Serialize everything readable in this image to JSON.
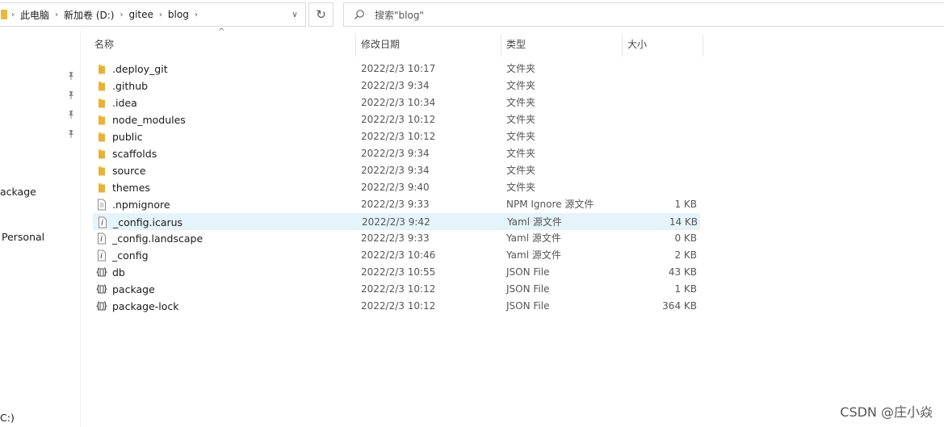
{
  "address": {
    "crumbs": [
      "此电脑",
      "新加卷 (D:)",
      "gitee",
      "blog"
    ],
    "dropdown_glyph": "∨",
    "refresh_glyph": "↻"
  },
  "search": {
    "placeholder": "搜索\"blog\"",
    "icon": "search-icon"
  },
  "nav": {
    "items": [
      {
        "label": "ackage"
      },
      {
        "label": "Personal"
      },
      {
        "label": "C:)"
      }
    ]
  },
  "columns": {
    "name": "名称",
    "date": "修改日期",
    "type": "类型",
    "size": "大小"
  },
  "files": [
    {
      "name": ".deploy_git",
      "date": "2022/2/3 10:17",
      "type": "文件夹",
      "size": "",
      "icon": "folder-icon"
    },
    {
      "name": ".github",
      "date": "2022/2/3 9:34",
      "type": "文件夹",
      "size": "",
      "icon": "folder-icon"
    },
    {
      "name": ".idea",
      "date": "2022/2/3 10:34",
      "type": "文件夹",
      "size": "",
      "icon": "folder-icon"
    },
    {
      "name": "node_modules",
      "date": "2022/2/3 10:12",
      "type": "文件夹",
      "size": "",
      "icon": "folder-icon"
    },
    {
      "name": "public",
      "date": "2022/2/3 10:12",
      "type": "文件夹",
      "size": "",
      "icon": "folder-icon"
    },
    {
      "name": "scaffolds",
      "date": "2022/2/3 9:34",
      "type": "文件夹",
      "size": "",
      "icon": "folder-icon"
    },
    {
      "name": "source",
      "date": "2022/2/3 9:34",
      "type": "文件夹",
      "size": "",
      "icon": "folder-icon"
    },
    {
      "name": "themes",
      "date": "2022/2/3 9:40",
      "type": "文件夹",
      "size": "",
      "icon": "folder-icon"
    },
    {
      "name": ".npmignore",
      "date": "2022/2/3 9:33",
      "type": "NPM Ignore 源文件",
      "size": "1 KB",
      "icon": "text-file-icon"
    },
    {
      "name": "_config.icarus",
      "date": "2022/2/3 9:42",
      "type": "Yaml 源文件",
      "size": "14 KB",
      "icon": "yaml-file-icon",
      "selected": true
    },
    {
      "name": "_config.landscape",
      "date": "2022/2/3 9:33",
      "type": "Yaml 源文件",
      "size": "0 KB",
      "icon": "yaml-file-icon"
    },
    {
      "name": "_config",
      "date": "2022/2/3 10:46",
      "type": "Yaml 源文件",
      "size": "2 KB",
      "icon": "yaml-file-icon"
    },
    {
      "name": "db",
      "date": "2022/2/3 10:55",
      "type": "JSON File",
      "size": "43 KB",
      "icon": "json-file-icon"
    },
    {
      "name": "package",
      "date": "2022/2/3 10:12",
      "type": "JSON File",
      "size": "1 KB",
      "icon": "json-file-icon"
    },
    {
      "name": "package-lock",
      "date": "2022/2/3 10:12",
      "type": "JSON File",
      "size": "364 KB",
      "icon": "json-file-icon"
    }
  ],
  "watermark": "CSDN @庄小焱"
}
